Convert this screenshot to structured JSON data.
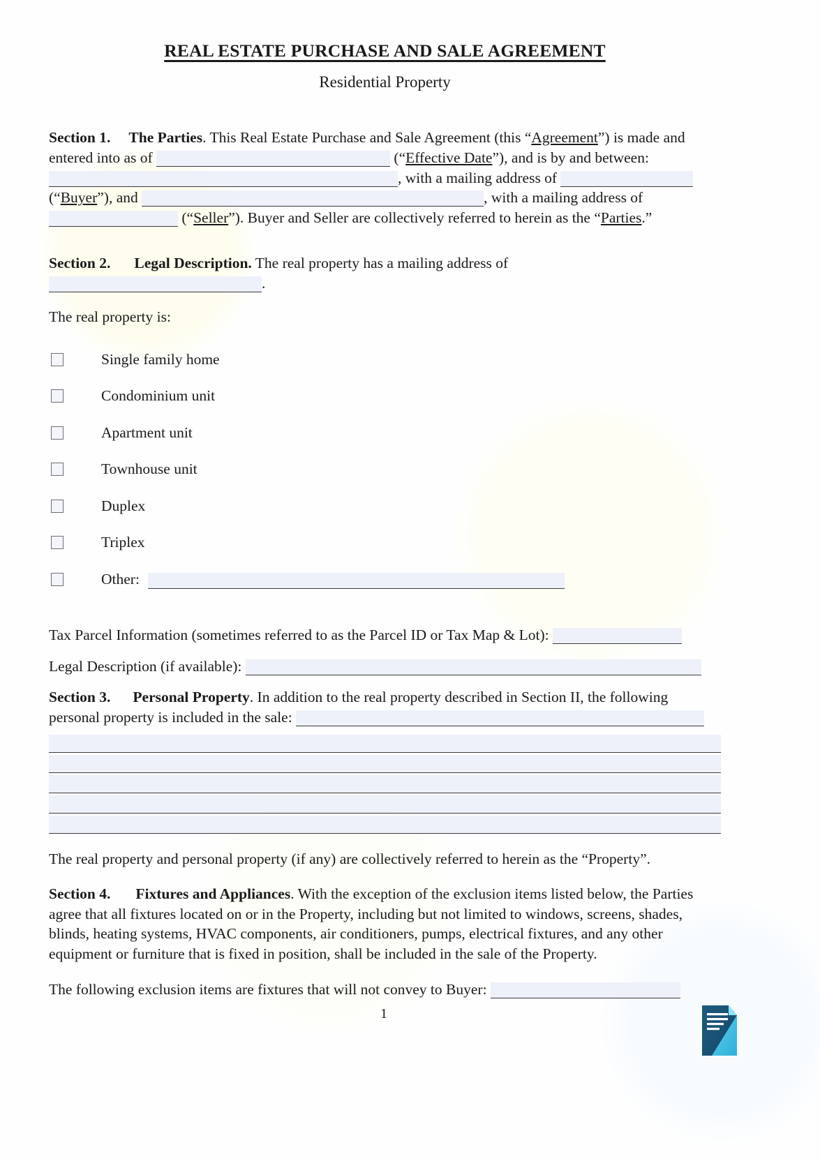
{
  "document": {
    "title": "REAL ESTATE PURCHASE AND SALE AGREEMENT",
    "subtitle": "Residential Property",
    "page_number": "1"
  },
  "section1": {
    "number": "Section 1.",
    "heading": "The Parties",
    "text_a": ". This Real Estate Purchase and Sale Agreement (this “",
    "term_agreement": "Agreement",
    "text_b": "”) is made and entered into as of",
    "text_c": "(“",
    "term_effective_date": "Effective Date",
    "text_d": "”), and is by and between:",
    "text_e": ", with a mailing address of",
    "text_f": "(“",
    "term_buyer": "Buyer",
    "text_g": "”), and",
    "text_h": ", with a mailing address of",
    "text_i": "(“",
    "term_seller": "Seller",
    "text_j": "”). Buyer and Seller are collectively referred to herein as the “",
    "term_parties": "Parties",
    "text_k": ".”",
    "field_effective_date": "",
    "field_buyer_name": "",
    "field_buyer_address": "",
    "field_seller_name": "",
    "field_seller_address": ""
  },
  "section2": {
    "number": "Section 2.",
    "heading": "Legal Description.",
    "text_a": " The real property has a mailing address of",
    "field_mailing_address": "",
    "period": ".",
    "property_is_label": "The real property is:",
    "checkboxes": [
      {
        "label": "Single family home",
        "checked": false,
        "has_field": false
      },
      {
        "label": "Condominium unit",
        "checked": false,
        "has_field": false
      },
      {
        "label": "Apartment unit",
        "checked": false,
        "has_field": false
      },
      {
        "label": "Townhouse unit",
        "checked": false,
        "has_field": false
      },
      {
        "label": "Duplex",
        "checked": false,
        "has_field": false
      },
      {
        "label": "Triplex",
        "checked": false,
        "has_field": false
      },
      {
        "label": "Other:",
        "checked": false,
        "has_field": true,
        "field_value": ""
      }
    ],
    "tax_parcel_label": "Tax Parcel Information (sometimes referred to as the Parcel ID or Tax Map & Lot):",
    "field_tax_parcel": "",
    "legal_desc_label": "Legal Description (if available):",
    "field_legal_desc": ""
  },
  "section3": {
    "number": "Section 3.",
    "heading": "Personal Property",
    "text_a": ". In addition to the real property described in Section II, the following personal property is included in the sale:",
    "field_personal_property": "",
    "blank_lines": [
      "",
      "",
      "",
      "",
      ""
    ],
    "closing_text": "The real property and personal property (if any) are collectively referred to herein as the “Property”."
  },
  "section4": {
    "number": "Section 4.",
    "heading": "Fixtures and Appliances",
    "text_a": ". With the exception of the exclusion items listed below, the Parties agree that all fixtures located on or in the Property, including but not limited to windows, screens, shades, blinds, heating systems, HVAC components, air conditioners, pumps, electrical fixtures, and any other equipment or furniture that is fixed in position, shall be included in the sale of the Property.",
    "exclusion_label": "The following exclusion items are fixtures that will not convey to Buyer:",
    "field_exclusions": ""
  },
  "logo": {
    "name": "document-logo-icon",
    "color_dark": "#1d5b7e",
    "color_light": "#3fc3e8",
    "color_mid": "#2a87ae"
  }
}
